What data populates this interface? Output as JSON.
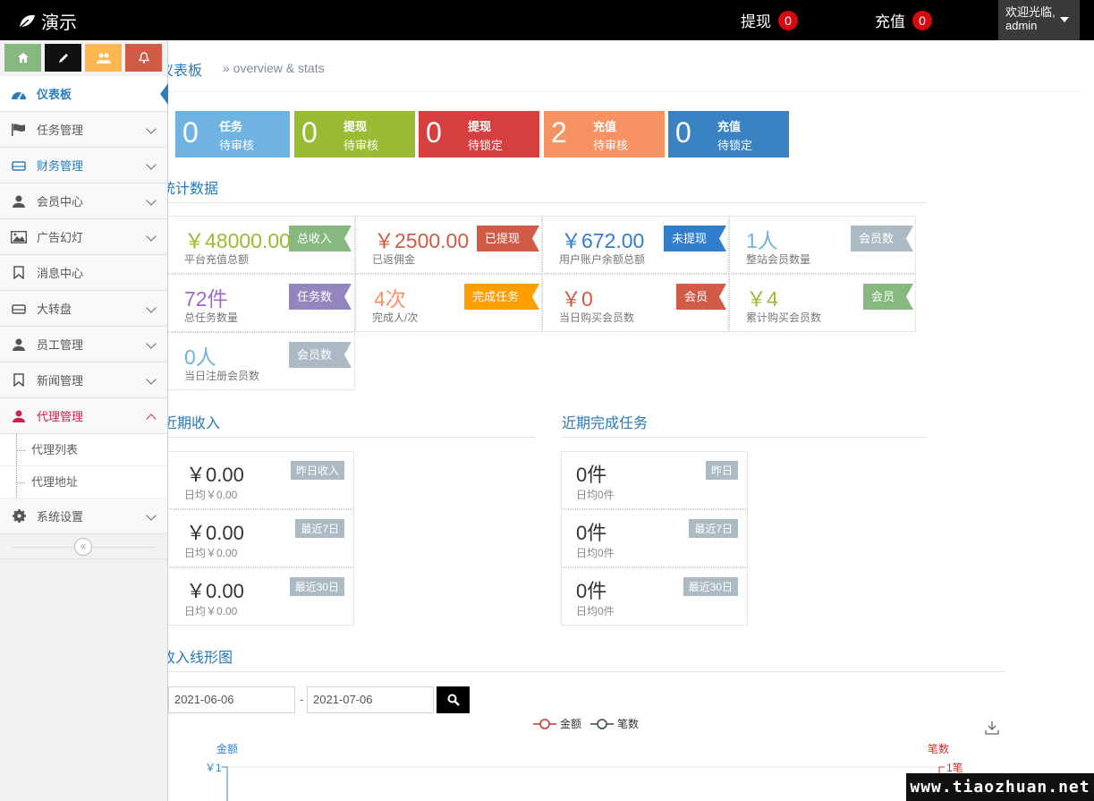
{
  "navbar": {
    "brand": "演示",
    "withdraw_label": "提现",
    "withdraw_count": "0",
    "recharge_label": "充值",
    "recharge_count": "0",
    "welcome": "欢迎光临,",
    "username": "admin"
  },
  "sidebar": {
    "items": [
      {
        "label": "仪表板"
      },
      {
        "label": "任务管理"
      },
      {
        "label": "财务管理"
      },
      {
        "label": "会员中心"
      },
      {
        "label": "广告幻灯"
      },
      {
        "label": "消息中心"
      },
      {
        "label": "大转盘"
      },
      {
        "label": "员工管理"
      },
      {
        "label": "新闻管理"
      },
      {
        "label": "代理管理"
      },
      {
        "label": "系统设置"
      }
    ],
    "submenu": [
      {
        "label": "代理列表"
      },
      {
        "label": "代理地址"
      }
    ],
    "collapse_glyph": "«"
  },
  "page_header": {
    "title": "仪表板",
    "subtitle": "» overview & stats"
  },
  "infoboxes": [
    {
      "num": "0",
      "line1": "任务",
      "line2": "待审核",
      "color": "#6fb3e0"
    },
    {
      "num": "0",
      "line1": "提现",
      "line2": "待审核",
      "color": "#9abc32"
    },
    {
      "num": "0",
      "line1": "提现",
      "line2": "待锁定",
      "color": "#d53f40"
    },
    {
      "num": "2",
      "line1": "充值",
      "line2": "待审核",
      "color": "#f79263"
    },
    {
      "num": "0",
      "line1": "充值",
      "line2": "待锁定",
      "color": "#3983c2"
    }
  ],
  "stats_title": "统计数据",
  "stats": [
    {
      "value": "￥48000.00",
      "desc": "平台充值总额",
      "tag": "总收入",
      "value_color": "#9abc32",
      "tag_color": "#87b87f"
    },
    {
      "value": "￥2500.00",
      "desc": "已返佣金",
      "tag": "已提现",
      "value_color": "#d15b47",
      "tag_color": "#d15b47"
    },
    {
      "value": "￥672.00",
      "desc": "用户账户余额总额",
      "tag": "未提现",
      "value_color": "#307ecc",
      "tag_color": "#307ecc"
    },
    {
      "value": "1人",
      "desc": "整站会员数量",
      "tag": "会员数",
      "value_color": "#6fb3e0",
      "tag_color": "#abbac3"
    },
    {
      "value": "72件",
      "desc": "总任务数量",
      "tag": "任务数",
      "value_color": "#a069c3",
      "tag_color": "#9585bf"
    },
    {
      "value": "4次",
      "desc": "完成人/次",
      "tag": "完成任务",
      "value_color": "#f79263",
      "tag_color": "#ff9e00"
    },
    {
      "value": "￥0",
      "desc": "当日购买会员数",
      "tag": "会员",
      "value_color": "#d15b47",
      "tag_color": "#d15b47"
    },
    {
      "value": "￥4",
      "desc": "累计购买会员数",
      "tag": "会员",
      "value_color": "#9abc32",
      "tag_color": "#87b87f"
    },
    {
      "value": "0人",
      "desc": "当日注册会员数",
      "tag": "会员数",
      "value_color": "#6fb3e0",
      "tag_color": "#abbac3"
    }
  ],
  "income": {
    "title": "近期收入",
    "rows": [
      {
        "value": "￥0.00",
        "desc": "日均￥0.00",
        "tag": "昨日收入"
      },
      {
        "value": "￥0.00",
        "desc": "日均￥0.00",
        "tag": "最近7日"
      },
      {
        "value": "￥0.00",
        "desc": "日均￥0.00",
        "tag": "最近30日"
      }
    ]
  },
  "tasks": {
    "title": "近期完成任务",
    "rows": [
      {
        "value": "0件",
        "desc": "日均0件",
        "tag": "昨日"
      },
      {
        "value": "0件",
        "desc": "日均0件",
        "tag": "最近7日"
      },
      {
        "value": "0件",
        "desc": "日均0件",
        "tag": "最近30日"
      }
    ]
  },
  "chart": {
    "title": "收入线形图",
    "date_from": "2021-06-06",
    "date_sep": "-",
    "date_to": "2021-07-06",
    "legend_amount": "金额",
    "legend_count": "笔数",
    "y_left_label": "金额",
    "y_left_tick": "￥1",
    "y_right_label": "笔数",
    "y_right_tick": "1笔",
    "amount_color": "#c23531",
    "count_color": "#2f4554"
  },
  "watermark": "www.tiaozhuan.net"
}
